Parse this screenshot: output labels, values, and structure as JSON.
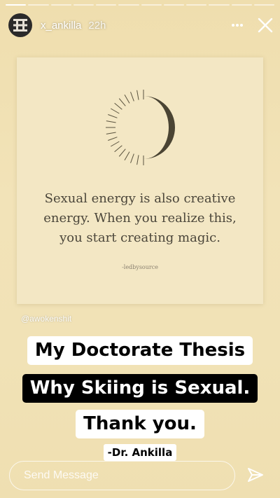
{
  "story": {
    "segments": [
      1,
      0,
      0,
      0,
      0,
      0,
      0,
      0,
      0,
      0,
      0,
      0
    ],
    "username": "x_ankilla",
    "timestamp": "22h"
  },
  "post": {
    "quote_lines": [
      "Sexual energy is also creative",
      "energy. When you realize this,",
      "you start creating magic."
    ],
    "credit": "-ledbysource"
  },
  "mention": "@awokenshit",
  "captions": {
    "line1": "My Doctorate Thesis",
    "line2": "Why Skiing is Sexual.",
    "line3": "Thank you.",
    "signature": "-Dr. Ankilla"
  },
  "composer": {
    "placeholder": "Send Message"
  },
  "icons": {
    "more": "more-options-icon",
    "close": "close-icon",
    "send": "send-icon",
    "moon": "crescent-moon-icon"
  },
  "colors": {
    "background": "#f0e1b3",
    "caption_white": "#ffffff",
    "caption_black": "#000000"
  }
}
